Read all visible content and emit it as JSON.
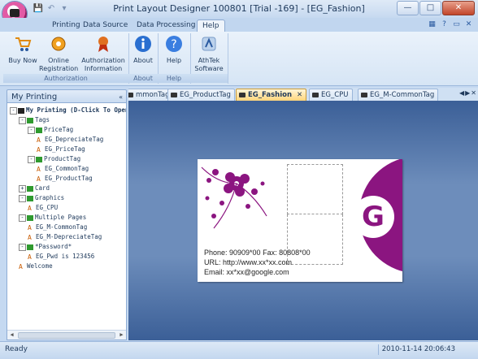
{
  "window": {
    "title": "Print Layout Designer 100801 [Trial -169] - [EG_Fashion]",
    "controls": {
      "minimize": "—",
      "maximize": "□",
      "close": "✕"
    }
  },
  "quick_access": [
    "💾",
    "↶",
    "▾"
  ],
  "ribbon": {
    "tabs": [
      "Printing",
      "Data Source",
      "Data Processing",
      "Help"
    ],
    "active_tab": "Help",
    "groups": [
      {
        "label": "Authorization",
        "buttons": [
          {
            "label": "Buy Now",
            "icon": "cart-icon"
          },
          {
            "label": "Online Registration",
            "icon": "gear-icon"
          },
          {
            "label": "Authorization Information",
            "icon": "ribbon-award-icon"
          }
        ]
      },
      {
        "label": "About",
        "buttons": [
          {
            "label": "About",
            "icon": "info-icon"
          }
        ]
      },
      {
        "label": "Help",
        "buttons": [
          {
            "label": "Help",
            "icon": "help-icon"
          }
        ]
      },
      {
        "label": "",
        "buttons": [
          {
            "label": "AthTek Software",
            "icon": "athtek-icon"
          }
        ]
      }
    ]
  },
  "left_pane": {
    "title": "My Printing",
    "tree": [
      {
        "label": "My Printing (D-Click To Open)",
        "level": 0,
        "toggle": "-",
        "kind": "root"
      },
      {
        "label": "Tags",
        "level": 1,
        "toggle": "-",
        "kind": "folder"
      },
      {
        "label": "PriceTag",
        "level": 2,
        "toggle": "-",
        "kind": "folder"
      },
      {
        "label": "EG_DepreciateTag",
        "level": 3,
        "kind": "tag"
      },
      {
        "label": "EG_PriceTag",
        "level": 3,
        "kind": "tag"
      },
      {
        "label": "ProductTag",
        "level": 2,
        "toggle": "-",
        "kind": "folder"
      },
      {
        "label": "EG_CommonTag",
        "level": 3,
        "kind": "tag"
      },
      {
        "label": "EG_ProductTag",
        "level": 3,
        "kind": "tag"
      },
      {
        "label": "Card",
        "level": 1,
        "toggle": "+",
        "kind": "folder"
      },
      {
        "label": "Graphics",
        "level": 1,
        "toggle": "-",
        "kind": "folder"
      },
      {
        "label": "EG_CPU",
        "level": 2,
        "kind": "tag"
      },
      {
        "label": "Multiple Pages",
        "level": 1,
        "toggle": "-",
        "kind": "folder"
      },
      {
        "label": "EG_M-CommonTag",
        "level": 2,
        "kind": "tag"
      },
      {
        "label": "EG_M-DepreciateTag",
        "level": 2,
        "kind": "tag"
      },
      {
        "label": "*Password*",
        "level": 1,
        "toggle": "-",
        "kind": "folder"
      },
      {
        "label": "EG_Pwd is 123456",
        "level": 2,
        "kind": "tag"
      },
      {
        "label": "Welcome",
        "level": 1,
        "kind": "tag"
      }
    ]
  },
  "doc_tabs": [
    {
      "label": "mmonTag"
    },
    {
      "label": "EG_ProductTag"
    },
    {
      "label": "EG_Fashion",
      "active": true
    },
    {
      "label": "EG_CPU"
    },
    {
      "label": "EG_M-CommonTag"
    }
  ],
  "doc_nav": [
    "◀",
    "▶",
    "✕"
  ],
  "card": {
    "badge": "G",
    "phone": "Phone: 90909*00  Fax: 80808*00",
    "url": "URL: http://www.xx*xx.com",
    "email": "Email: xx*xx@google.com",
    "accent_color": "#8b1580"
  },
  "status": {
    "left": "Ready",
    "right": "2010-11-14 20:06:43"
  }
}
